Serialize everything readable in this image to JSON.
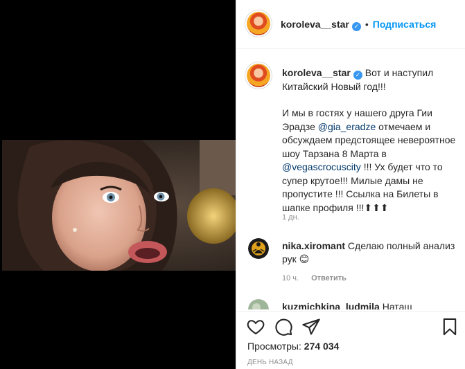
{
  "header": {
    "username": "koroleva__star",
    "dot": "•",
    "follow_label": "Подписаться"
  },
  "caption": {
    "username": "koroleva__star",
    "line1": "Вот и наступил Китайский Новый год!!!",
    "p2_before": "И мы в гостях у нашего друга Гии Эрадзе ",
    "mention1": "@gia_eradze",
    "p2_mid": " отмечаем и обсуждаем предстоящее невероятное шоу Тарзана 8 Марта в ",
    "mention2": "@vegascrocuscity",
    "p2_after": " !!! Ух будет что то супер крутое!!! Милые дамы не пропустите !!! Ссылка на Билеты в шапке профиля !!!⬆⬆⬆",
    "time": "1 дн."
  },
  "comments": [
    {
      "username": "nika.xiromant",
      "text": "Сделаю полный анализ рук 😊",
      "time": "10 ч.",
      "reply": "Ответить"
    },
    {
      "username": "kuzmichkina_ludmila",
      "text": "Наташ"
    }
  ],
  "footer": {
    "views_label": "Просмотры:",
    "views_count": "274 034",
    "date": "ДЕНЬ НАЗАД"
  },
  "icons": [
    "heart-icon",
    "comment-icon",
    "share-icon",
    "bookmark-icon",
    "verified-badge-icon"
  ],
  "colors": {
    "accent": "#0095f6",
    "verified": "#3897f0",
    "mention": "#00376b",
    "muted": "#8e8e8e"
  }
}
